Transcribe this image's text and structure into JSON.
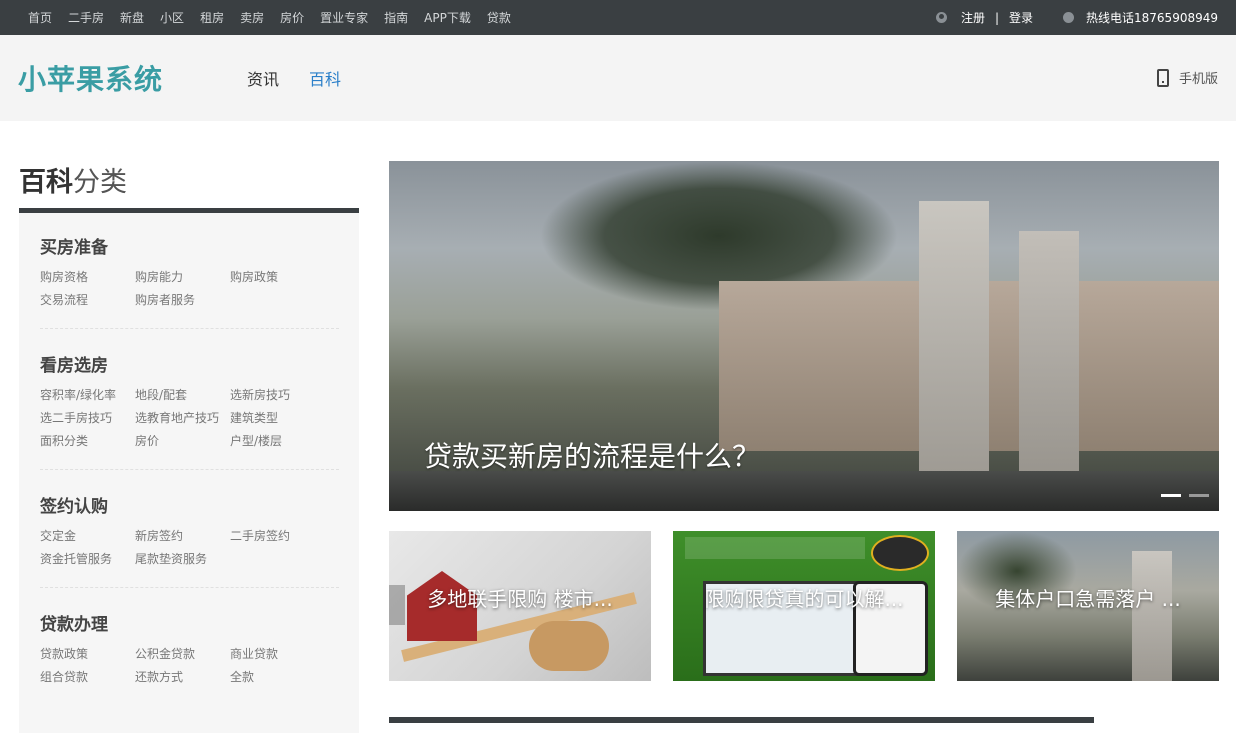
{
  "topbar": {
    "nav": [
      "首页",
      "二手房",
      "新盘",
      "小区",
      "租房",
      "卖房",
      "房价",
      "置业专家",
      "指南",
      "APP下载",
      "贷款"
    ],
    "register": "注册",
    "separator": "|",
    "login": "登录",
    "hotline": "热线电话18765908949"
  },
  "header": {
    "logo": "小苹果系统",
    "nav": [
      {
        "label": "资讯"
      },
      {
        "label": "百科"
      }
    ],
    "mobile": "手机版"
  },
  "sidebar": {
    "title_bold": "百科",
    "title_light": "分类",
    "categories": [
      {
        "name": "买房准备",
        "links": [
          "购房资格",
          "购房能力",
          "购房政策",
          "交易流程",
          "购房者服务"
        ]
      },
      {
        "name": "看房选房",
        "links": [
          "容积率/绿化率",
          "地段/配套",
          "选新房技巧",
          "选二手房技巧",
          "选教育地产技巧",
          "建筑类型",
          "面积分类",
          "房价",
          "户型/楼层"
        ]
      },
      {
        "name": "签约认购",
        "links": [
          "交定金",
          "新房签约",
          "二手房签约",
          "资金托管服务",
          "尾款垫资服务"
        ]
      },
      {
        "name": "贷款办理",
        "links": [
          "贷款政策",
          "公积金贷款",
          "商业贷款",
          "组合贷款",
          "还款方式",
          "全款"
        ]
      }
    ]
  },
  "main": {
    "hero_caption": "贷款买新房的流程是什么？",
    "thumbs": [
      {
        "caption": "多地联手限购 楼市..."
      },
      {
        "caption": "限购限贷真的可以解..."
      },
      {
        "caption": "集体户口急需落户 ..."
      }
    ]
  },
  "colors": {
    "topbar_bg": "#3a3f42",
    "accent_link": "#2a7fc9",
    "logo": "#3a9da4"
  }
}
